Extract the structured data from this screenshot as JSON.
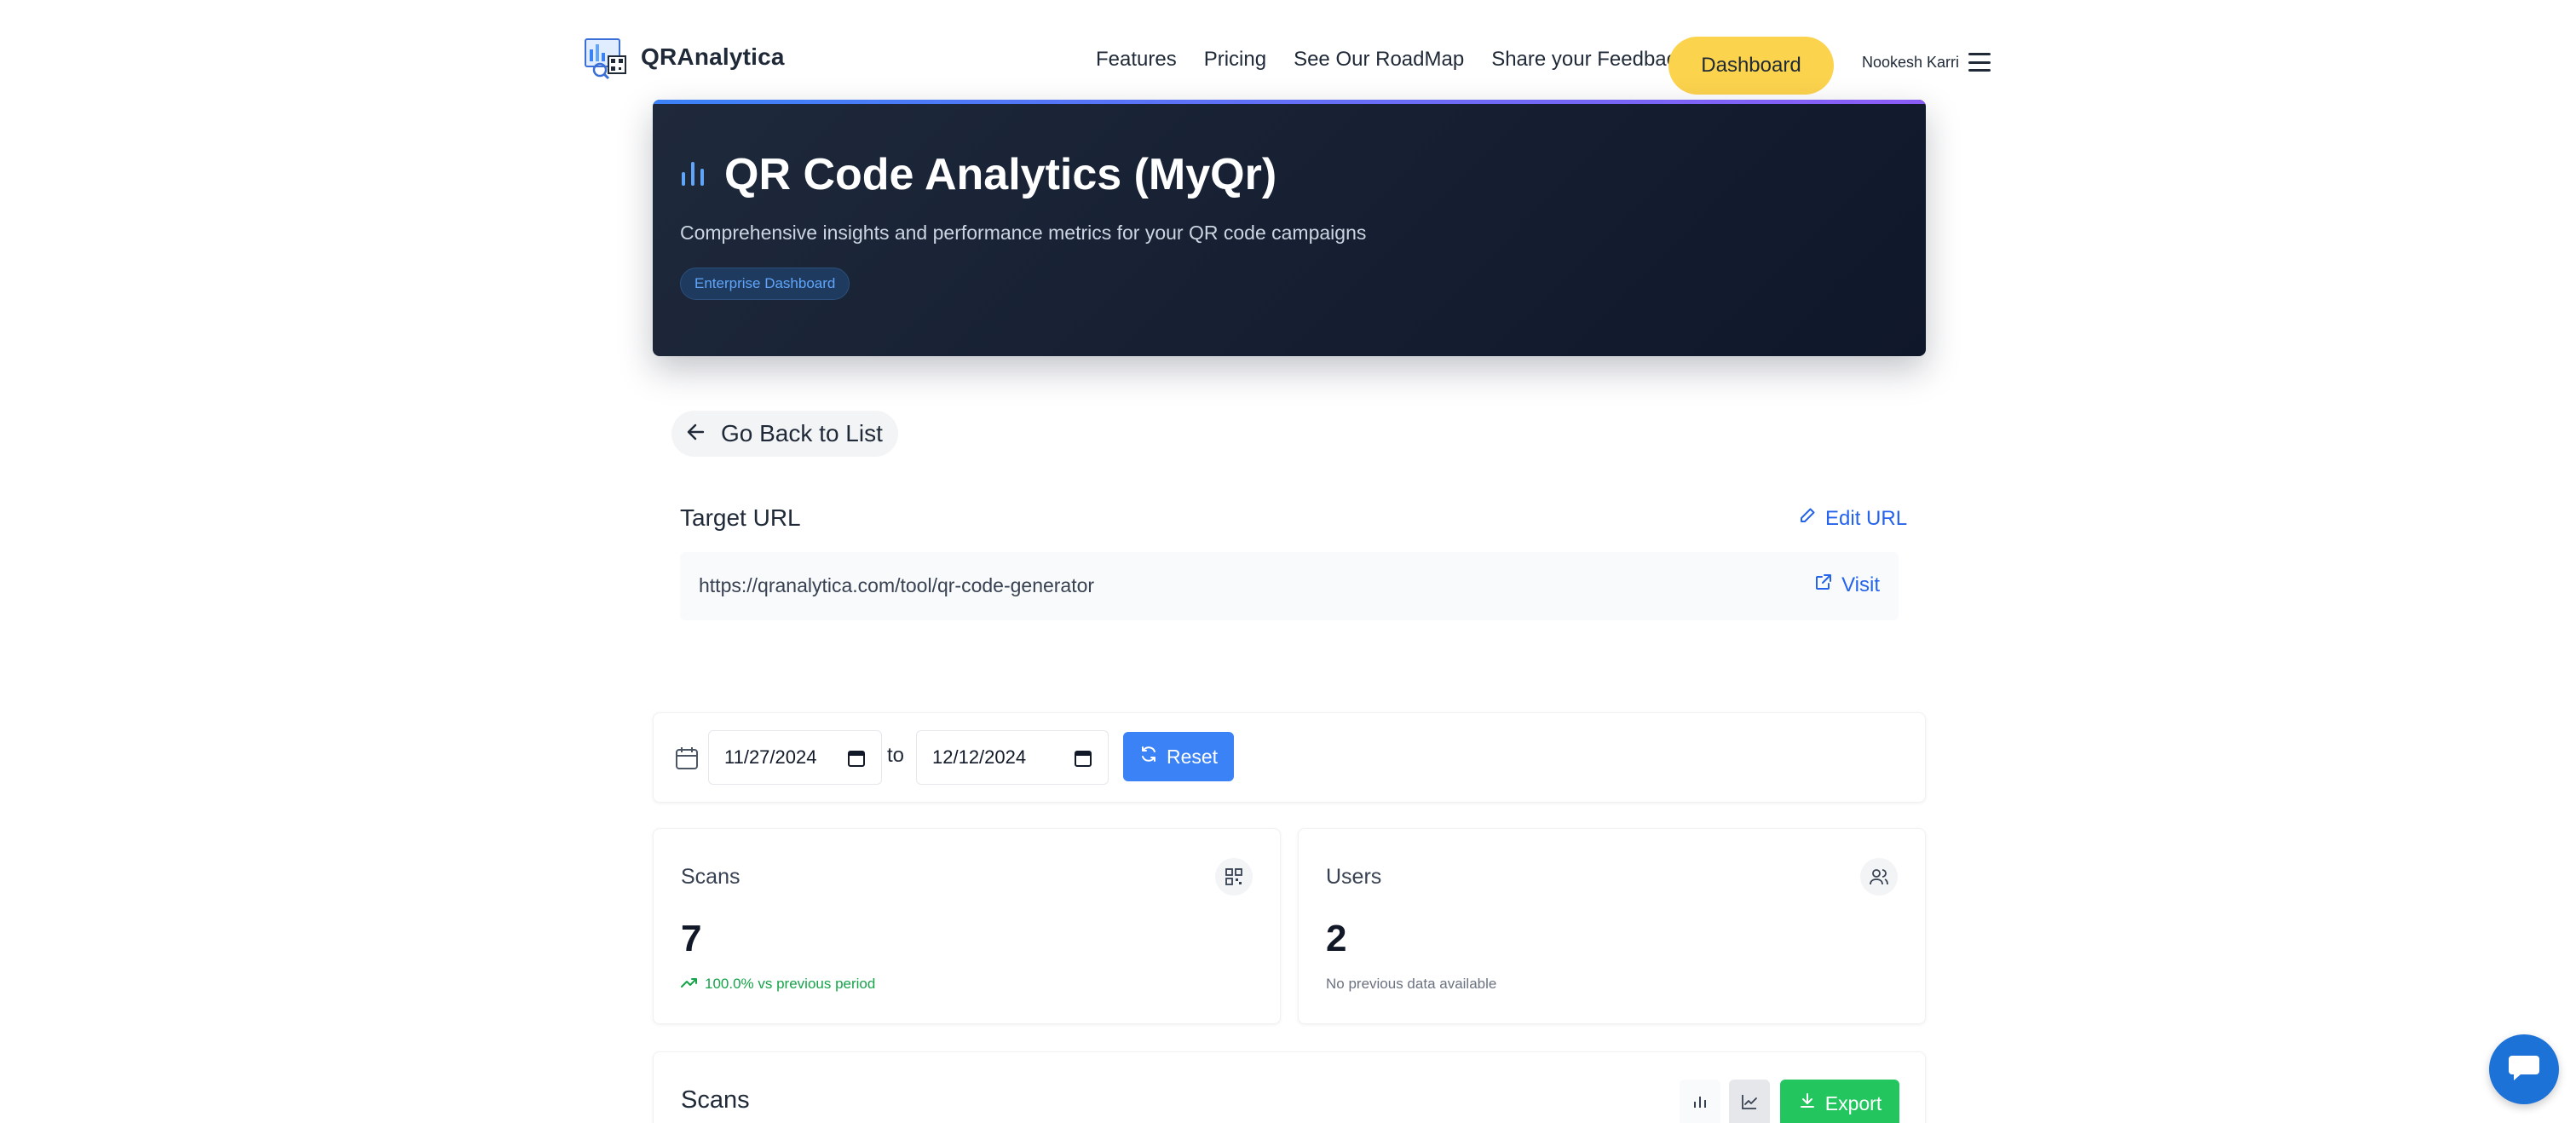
{
  "nav": {
    "logo_text": "QRAnalytica",
    "links": [
      "Features",
      "Pricing",
      "See Our RoadMap",
      "Share your Feedback"
    ],
    "dashboard_label": "Dashboard",
    "user_name": "Nookesh Karri"
  },
  "hero": {
    "title": "QR Code Analytics (MyQr)",
    "subtitle": "Comprehensive insights and performance metrics for your QR code campaigns",
    "badge": "Enterprise Dashboard"
  },
  "back": {
    "label": "Go Back to List"
  },
  "target": {
    "title": "Target URL",
    "edit_label": "Edit URL",
    "url": "https://qranalytica.com/tool/qr-code-generator",
    "visit_label": "Visit"
  },
  "filter": {
    "start_date": "11/27/2024",
    "to_label": "to",
    "end_date": "12/12/2024",
    "reset_label": "Reset"
  },
  "stats": {
    "scans": {
      "label": "Scans",
      "value": "7",
      "note": "100.0% vs previous period"
    },
    "users": {
      "label": "Users",
      "value": "2",
      "note": "No previous data available"
    }
  },
  "scans_chart": {
    "title": "Scans",
    "export_label": "Export"
  },
  "colors": {
    "accent": "#3b82f6",
    "dashboard_button": "#fcd34d",
    "export_button": "#22c55e",
    "positive": "#16a34a",
    "hero_bg": "#0f172a"
  },
  "icons": {
    "hero": "bar-chart-icon",
    "back": "arrow-left-icon",
    "edit": "pencil-icon",
    "visit": "external-link-icon",
    "calendar": "calendar-icon",
    "reset": "refresh-icon",
    "scans": "qr-code-icon",
    "users": "users-icon",
    "trend": "trending-up-icon",
    "bar_toggle": "bar-chart-icon",
    "line_toggle": "line-chart-icon",
    "export": "download-icon",
    "chat": "chat-icon"
  }
}
